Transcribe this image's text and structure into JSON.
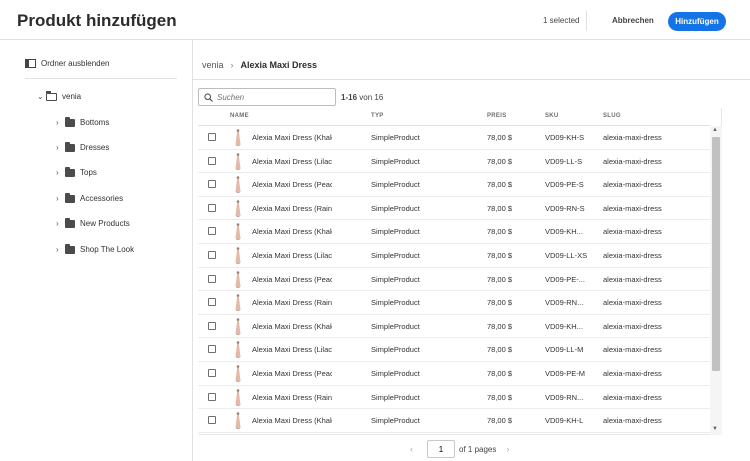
{
  "header": {
    "title": "Produkt hinzufügen",
    "selected_text": "1 selected",
    "cancel_label": "Abbrechen",
    "add_label": "Hinzufügen",
    "accent_color": "#1473e6"
  },
  "sidebar": {
    "hide_folders_label": "Ordner ausblenden",
    "root": "venia",
    "folders": [
      "Bottoms",
      "Dresses",
      "Tops",
      "Accessories",
      "New Products",
      "Shop The Look"
    ]
  },
  "breadcrumb": {
    "root": "venia",
    "separator": "›",
    "current": "Alexia Maxi Dress"
  },
  "search": {
    "placeholder": "Suchen",
    "range": "1-16",
    "total_text": "von 16"
  },
  "table": {
    "columns": [
      "NAME",
      "TYP",
      "PREIS",
      "SKU",
      "SLUG"
    ],
    "rows": [
      {
        "name": "Alexia Maxi Dress (Khaki",
        "type": "SimpleProduct",
        "price": "78,00 $",
        "sku": "VD09-KH-S",
        "slug": "alexia-maxi-dress"
      },
      {
        "name": "Alexia Maxi Dress (Lilac,",
        "type": "SimpleProduct",
        "price": "78,00 $",
        "sku": "VD09-LL-S",
        "slug": "alexia-maxi-dress"
      },
      {
        "name": "Alexia Maxi Dress (Peach",
        "type": "SimpleProduct",
        "price": "78,00 $",
        "sku": "VD09-PE-S",
        "slug": "alexia-maxi-dress"
      },
      {
        "name": "Alexia Maxi Dress (Rain,",
        "type": "SimpleProduct",
        "price": "78,00 $",
        "sku": "VD09-RN-S",
        "slug": "alexia-maxi-dress"
      },
      {
        "name": "Alexia Maxi Dress (Khaki",
        "type": "SimpleProduct",
        "price": "78,00 $",
        "sku": "VD09-KH...",
        "slug": "alexia-maxi-dress"
      },
      {
        "name": "Alexia Maxi Dress (Lilac,",
        "type": "SimpleProduct",
        "price": "78,00 $",
        "sku": "VD09-LL-XS",
        "slug": "alexia-maxi-dress"
      },
      {
        "name": "Alexia Maxi Dress (Peach",
        "type": "SimpleProduct",
        "price": "78,00 $",
        "sku": "VD09-PE-...",
        "slug": "alexia-maxi-dress"
      },
      {
        "name": "Alexia Maxi Dress (Rain,",
        "type": "SimpleProduct",
        "price": "78,00 $",
        "sku": "VD09-RN...",
        "slug": "alexia-maxi-dress"
      },
      {
        "name": "Alexia Maxi Dress (Khaki",
        "type": "SimpleProduct",
        "price": "78,00 $",
        "sku": "VD09-KH...",
        "slug": "alexia-maxi-dress"
      },
      {
        "name": "Alexia Maxi Dress (Lilac,",
        "type": "SimpleProduct",
        "price": "78,00 $",
        "sku": "VD09-LL-M",
        "slug": "alexia-maxi-dress"
      },
      {
        "name": "Alexia Maxi Dress (Peach",
        "type": "SimpleProduct",
        "price": "78,00 $",
        "sku": "VD09-PE-M",
        "slug": "alexia-maxi-dress"
      },
      {
        "name": "Alexia Maxi Dress (Rain,",
        "type": "SimpleProduct",
        "price": "78,00 $",
        "sku": "VD09-RN...",
        "slug": "alexia-maxi-dress"
      },
      {
        "name": "Alexia Maxi Dress (Khaki",
        "type": "SimpleProduct",
        "price": "78,00 $",
        "sku": "VD09-KH-L",
        "slug": "alexia-maxi-dress"
      }
    ]
  },
  "pagination": {
    "page": "1",
    "of_pages": "of 1 pages",
    "prev": "‹",
    "next": "›"
  }
}
